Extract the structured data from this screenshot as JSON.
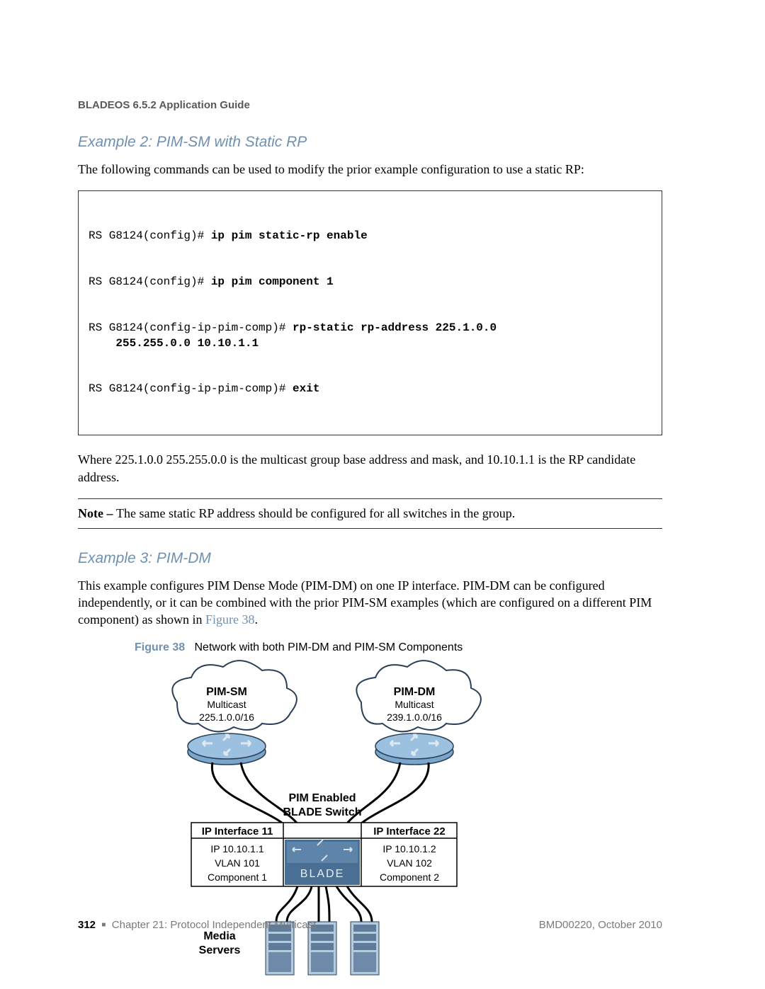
{
  "header": {
    "doc_title": "BLADEOS 6.5.2 Application Guide"
  },
  "example2": {
    "heading": "Example 2: PIM-SM with Static RP",
    "intro": "The following commands can be used to modify the prior example configuration to use a static RP:",
    "code": {
      "p1": "RS G8124(config)# ",
      "c1": "ip pim static-rp enable",
      "p2": "RS G8124(config)# ",
      "c2": "ip pim component 1",
      "p3": "RS G8124(config-ip-pim-comp)# ",
      "c3": "rp-static rp-address 225.1.0.0 255.255.0.0 10.10.1.1",
      "p4": "RS G8124(config-ip-pim-comp)# ",
      "c4": "exit"
    },
    "followup": "Where 225.1.0.0 255.255.0.0 is the multicast group base address and mask, and 10.10.1.1 is the RP candidate address.",
    "note_label": "Note – ",
    "note_text": "The same static RP address should be configured for all switches in the group."
  },
  "example3": {
    "heading": "Example 3: PIM-DM",
    "body_part1": "This example configures PIM Dense Mode (PIM-DM) on one IP interface. PIM-DM can be configured independently, or it can be combined with the prior PIM-SM examples (which are configured on a different PIM component) as shown in ",
    "figure_link": "Figure 38",
    "body_part2": "."
  },
  "figure": {
    "label": "Figure 38",
    "caption": "Network with both PIM-DM and PIM-SM Components",
    "cloud_left_title": "PIM-SM",
    "cloud_left_sub1": "Multicast",
    "cloud_left_sub2": "225.1.0.0/16",
    "cloud_right_title": "PIM-DM",
    "cloud_right_sub1": "Multicast",
    "cloud_right_sub2": "239.1.0.0/16",
    "switch_label1": "PIM Enabled",
    "switch_label2": "BLADE Switch",
    "if_left_title": "IP Interface 11",
    "if_left_l1": "IP 10.10.1.1",
    "if_left_l2": "VLAN 101",
    "if_left_l3": "Component 1",
    "if_right_title": "IP Interface 22",
    "if_right_l1": "IP 10.10.1.2",
    "if_right_l2": "VLAN 102",
    "if_right_l3": "Component 2",
    "media_label1": "Media",
    "media_label2": "Servers",
    "blade_logo": "BLADE"
  },
  "footer": {
    "page_num": "312",
    "chapter": "Chapter 21: Protocol Independent Multicast",
    "doc_ref": "BMD00220, October 2010"
  }
}
